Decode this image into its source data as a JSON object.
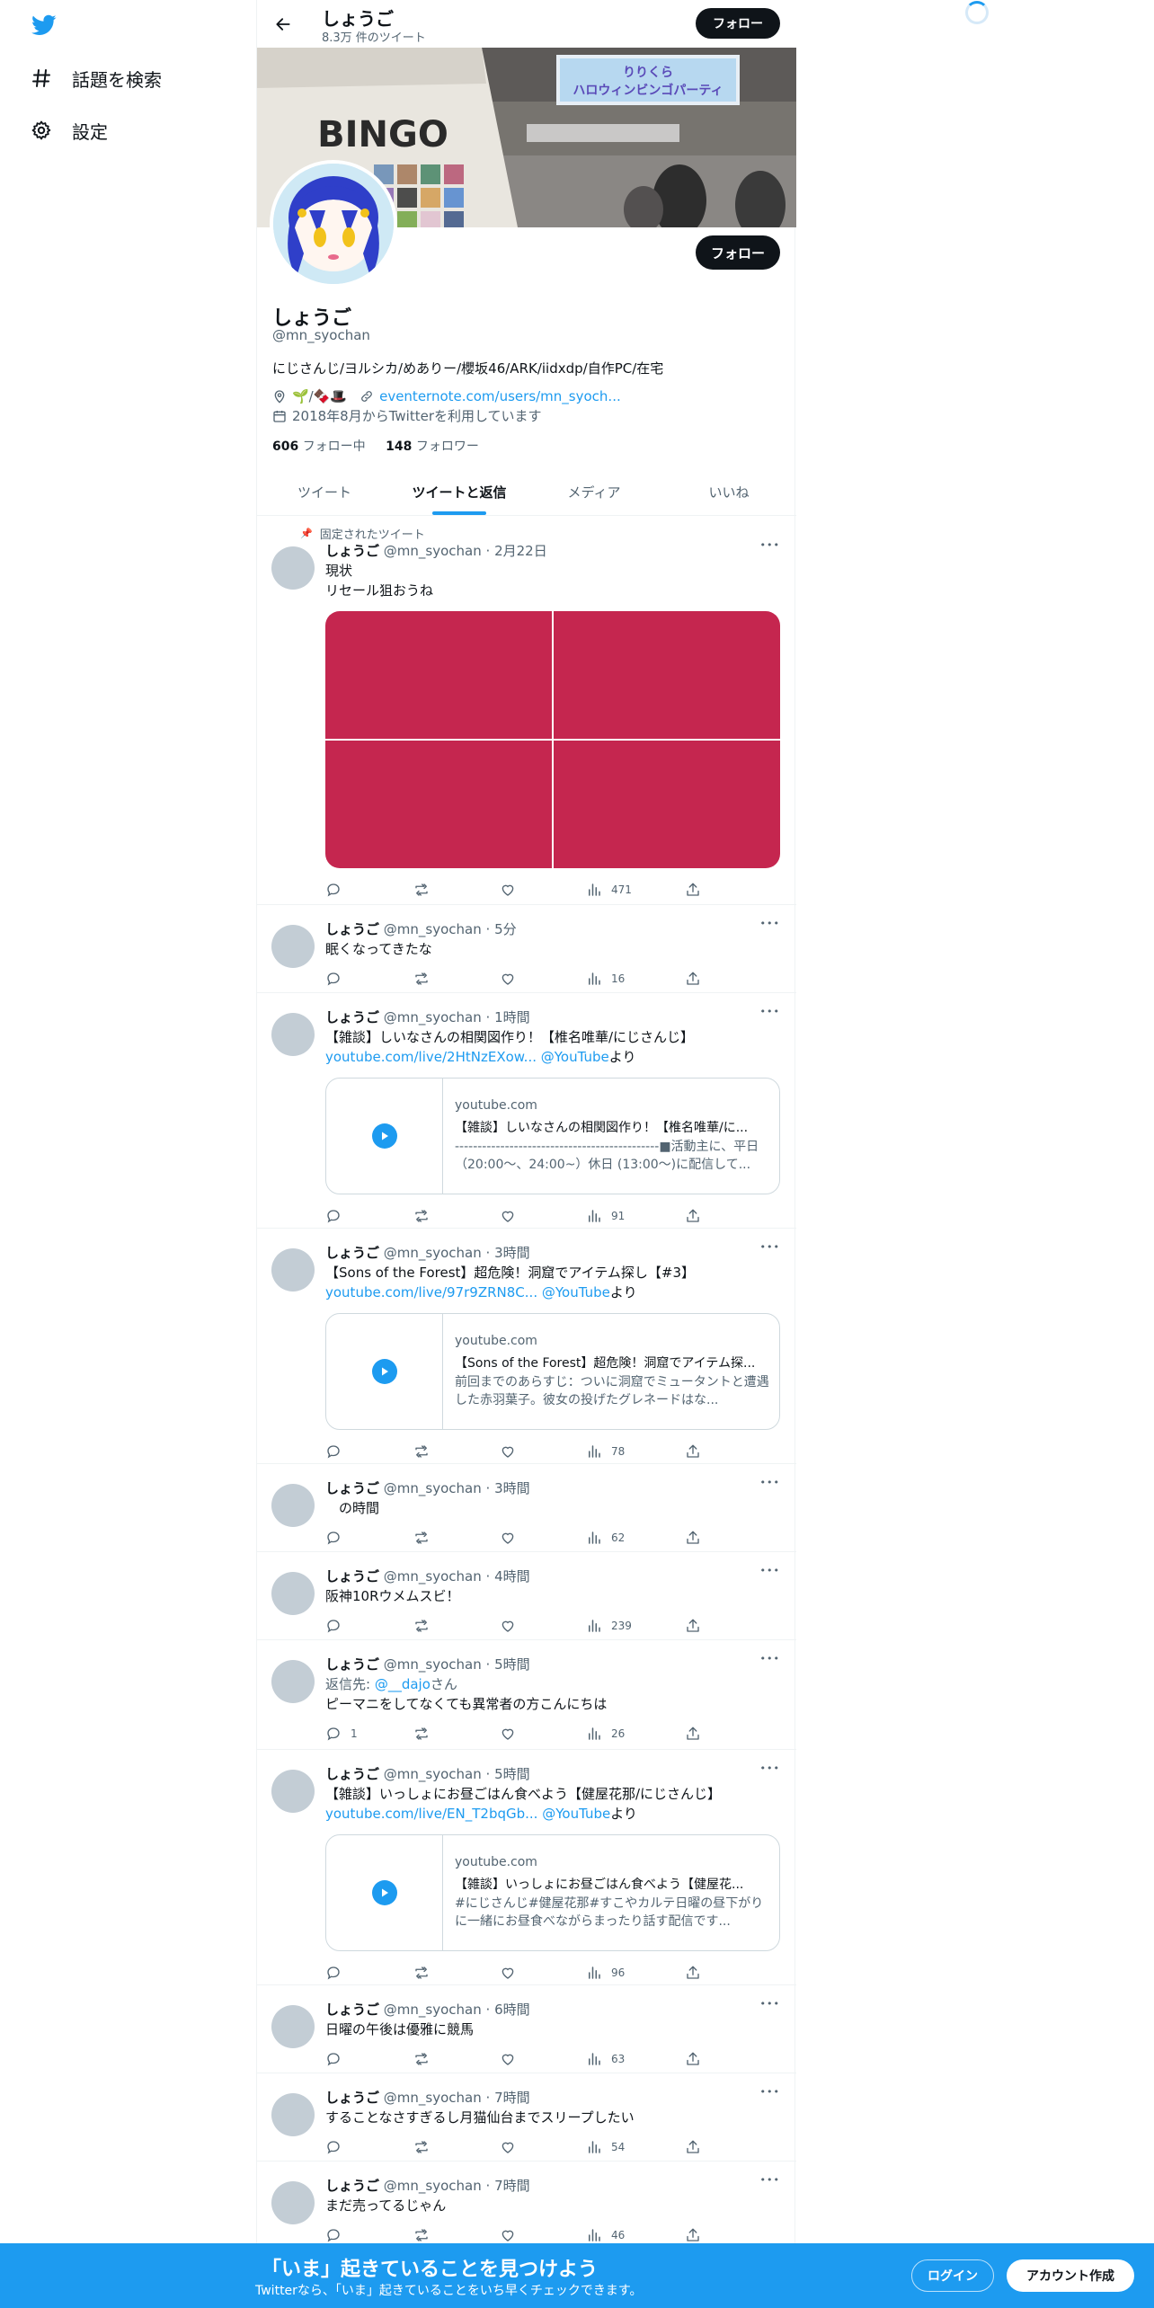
{
  "nav": {
    "items": [
      {
        "label": "話題を検索",
        "icon": "hashtag-icon"
      },
      {
        "label": "設定",
        "icon": "gear-icon"
      }
    ]
  },
  "topbar": {
    "name": "しょうご",
    "tweet_count": "8.3万 件のツイート",
    "follow_label": "フォロー"
  },
  "profile": {
    "name": "しょうご",
    "handle": "@mn_syochan",
    "bio": "にじさんじ/ヨルシカ/めありー/櫻坂46/ARK/iidxdp/自作PC/在宅",
    "location": "🌱/🍫🎩",
    "website": "eventernote.com/users/mn_syoch...",
    "joined": "2018年8月からTwitterを利用しています",
    "following_count": "606",
    "following_label": "フォロー中",
    "followers_count": "148",
    "followers_label": "フォロワー",
    "follow_label": "フォロー",
    "banner_text": {
      "sign": "りりくら\nハロウィンビンゴパーティ",
      "bingo": "BINGO"
    }
  },
  "tabs": [
    {
      "label": "ツイート",
      "active": false
    },
    {
      "label": "ツイートと返信",
      "active": true
    },
    {
      "label": "メディア",
      "active": false
    },
    {
      "label": "いいね",
      "active": false
    }
  ],
  "pinned_label": "固定されたツイート",
  "tweets": [
    {
      "name": "しょうご",
      "handle": "@mn_syochan",
      "time": "· 2月22日",
      "lines": [
        "現状",
        "リセール狙おうね"
      ],
      "views": "471",
      "replies": "",
      "media_color": "#c5264f"
    },
    {
      "name": "しょうご",
      "handle": "@mn_syochan",
      "time": "· 5分",
      "lines": [
        "眠くなってきたな"
      ],
      "views": "16",
      "replies": ""
    },
    {
      "name": "しょうご",
      "handle": "@mn_syochan",
      "time": "· 1時間",
      "lines": [
        "【雑談】しいなさんの相関図作り！【椎名唯華/にじさんじ】"
      ],
      "link": "youtube.com/live/2HtNzEXow...",
      "via": "@YouTube",
      "via_suffix": "より",
      "card": {
        "domain": "youtube.com",
        "title": "【雑談】しいなさんの相関図作り！【椎名唯華/に...",
        "desc": "---------------------------------------------■活動主に、平日（20:00～、24:00~）休日 (13:00～)に配信して..."
      },
      "views": "91",
      "replies": ""
    },
    {
      "name": "しょうご",
      "handle": "@mn_syochan",
      "time": "· 3時間",
      "lines": [
        "【Sons of the Forest】超危険！洞窟でアイテム探し【#3】"
      ],
      "link": "youtube.com/live/97r9ZRN8C...",
      "via": "@YouTube",
      "via_suffix": "より",
      "card": {
        "domain": "youtube.com",
        "title": "【Sons of the Forest】超危険！洞窟でアイテム探...",
        "desc": "前回までのあらすじ：ついに洞窟でミュータントと遭遇した赤羽葉子。彼女の投げたグレネードはな..."
      },
      "views": "78",
      "replies": ""
    },
    {
      "name": "しょうご",
      "handle": "@mn_syochan",
      "time": "· 3時間",
      "lines": [
        "　の時間"
      ],
      "views": "62",
      "replies": ""
    },
    {
      "name": "しょうご",
      "handle": "@mn_syochan",
      "time": "· 4時間",
      "lines": [
        "阪神10Rウメムスビ！"
      ],
      "views": "239",
      "replies": ""
    },
    {
      "name": "しょうご",
      "handle": "@mn_syochan",
      "time": "· 5時間",
      "reply_to_prefix": "返信先: ",
      "reply_to": "@__dajo",
      "reply_to_suffix": "さん",
      "lines": [
        "ピーマニをしてなくても異常者の方こんにちは"
      ],
      "views": "26",
      "replies": "1"
    },
    {
      "name": "しょうご",
      "handle": "@mn_syochan",
      "time": "· 5時間",
      "lines": [
        "【雑談】いっしょにお昼ごはん食べよう【健屋花那/にじさんじ】"
      ],
      "link": "youtube.com/live/EN_T2bqGb...",
      "via": "@YouTube",
      "via_suffix": "より",
      "card": {
        "domain": "youtube.com",
        "title": "【雑談】いっしょにお昼ごはん食べよう【健屋花...",
        "desc": "#にじさんじ#健屋花那#すこやカルテ日曜の昼下がりに一緒にお昼食べながらまったり話す配信です..."
      },
      "views": "96",
      "replies": ""
    },
    {
      "name": "しょうご",
      "handle": "@mn_syochan",
      "time": "· 6時間",
      "lines": [
        "日曜の午後は優雅に競馬"
      ],
      "views": "63",
      "replies": ""
    },
    {
      "name": "しょうご",
      "handle": "@mn_syochan",
      "time": "· 7時間",
      "lines": [
        "することなさすぎるし月猫仙台までスリープしたい"
      ],
      "views": "54",
      "replies": ""
    },
    {
      "name": "しょうご",
      "handle": "@mn_syochan",
      "time": "· 7時間",
      "lines": [
        "まだ売ってるじゃん"
      ],
      "views": "46",
      "replies": ""
    }
  ],
  "bottom_bar": {
    "title": "「いま」起きていることを見つけよう",
    "subtitle": "Twitterなら、「いま」起きていることをいち早くチェックできます。",
    "login": "ログイン",
    "signup": "アカウント作成"
  },
  "colors": {
    "accent": "#1d9bf0",
    "text": "#0f1419",
    "secondary": "#536471"
  }
}
